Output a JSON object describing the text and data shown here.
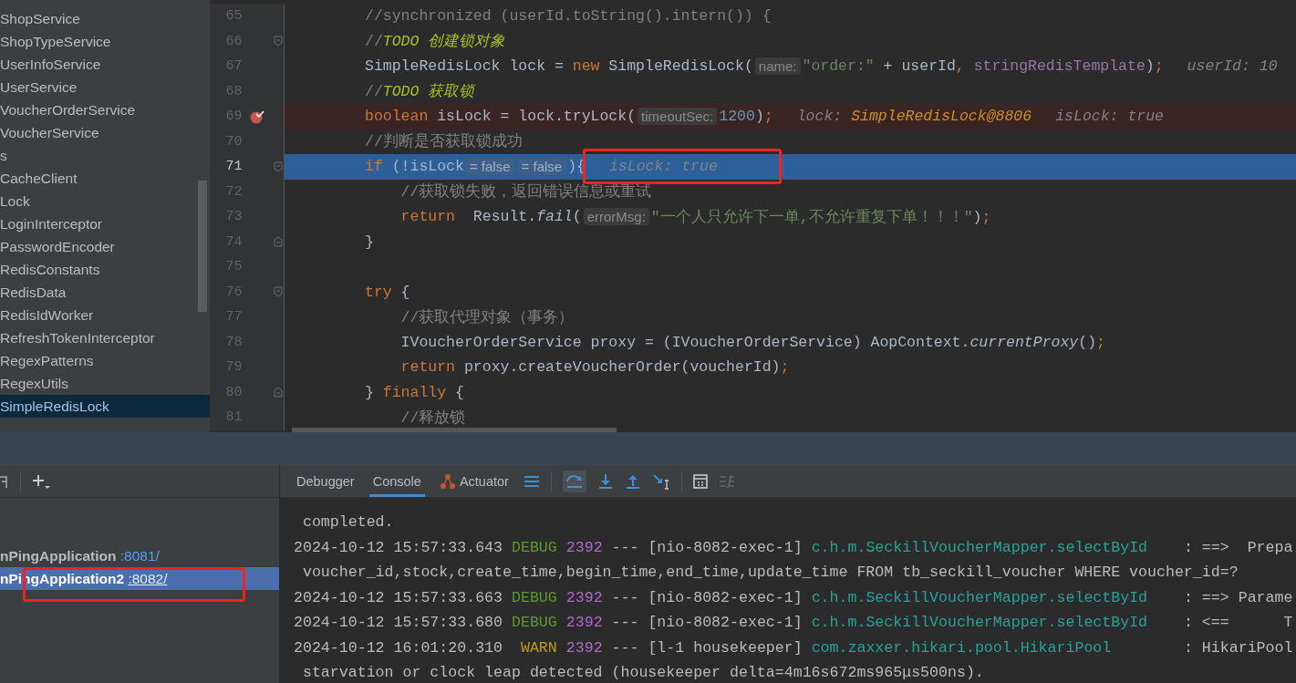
{
  "project_tree": {
    "items": [
      {
        "label": "ShopService",
        "selected": false
      },
      {
        "label": "ShopTypeService",
        "selected": false
      },
      {
        "label": "UserInfoService",
        "selected": false
      },
      {
        "label": "UserService",
        "selected": false
      },
      {
        "label": "VoucherOrderService",
        "selected": false
      },
      {
        "label": "VoucherService",
        "selected": false
      },
      {
        "label": "s",
        "selected": false
      },
      {
        "label": "CacheClient",
        "selected": false
      },
      {
        "label": "Lock",
        "selected": false
      },
      {
        "label": "LoginInterceptor",
        "selected": false
      },
      {
        "label": "PasswordEncoder",
        "selected": false
      },
      {
        "label": "RedisConstants",
        "selected": false
      },
      {
        "label": "RedisData",
        "selected": false
      },
      {
        "label": "RedisIdWorker",
        "selected": false
      },
      {
        "label": "RefreshTokenInterceptor",
        "selected": false
      },
      {
        "label": "RegexPatterns",
        "selected": false
      },
      {
        "label": "RegexUtils",
        "selected": false
      },
      {
        "label": "SimpleRedisLock",
        "selected": true
      }
    ]
  },
  "editor": {
    "lines": [
      {
        "number": "65",
        "parts": [
          {
            "kind": "code",
            "tokens": [
              {
                "kind": "comment",
                "text": "//synchronized (userId.toString().intern()) {"
              }
            ]
          }
        ]
      },
      {
        "number": "66",
        "fold_start": true,
        "parts": [
          {
            "kind": "code",
            "tokens": [
              {
                "kind": "comment",
                "text": "//"
              },
              {
                "kind": "todo",
                "text": "TODO 创建锁对象"
              }
            ]
          }
        ]
      },
      {
        "number": "67",
        "parts": [
          {
            "kind": "code",
            "tokens": [
              {
                "kind": "plain",
                "text": "SimpleRedisLock lock = "
              },
              {
                "kind": "kw",
                "text": "new"
              },
              {
                "kind": "plain",
                "text": " SimpleRedisLock("
              }
            ]
          },
          {
            "kind": "hint",
            "text": "name:"
          },
          {
            "kind": "code",
            "tokens": [
              {
                "kind": "string",
                "text": "\"order:\""
              },
              {
                "kind": "plain",
                "text": " + userId"
              },
              {
                "kind": "kw",
                "text": ", "
              },
              {
                "kind": "field",
                "text": "stringRedisTemplate"
              },
              {
                "kind": "plain",
                "text": ")"
              },
              {
                "kind": "kw",
                "text": ";"
              }
            ]
          },
          {
            "kind": "debug",
            "tokens": [
              {
                "kind": "vlabel",
                "text": "userId: 10"
              }
            ]
          }
        ]
      },
      {
        "number": "68",
        "parts": [
          {
            "kind": "code",
            "tokens": [
              {
                "kind": "comment",
                "text": "//"
              },
              {
                "kind": "todo",
                "text": "TODO 获取锁"
              }
            ]
          }
        ]
      },
      {
        "number": "69",
        "breakpoint": true,
        "parts": [
          {
            "kind": "code",
            "tokens": [
              {
                "kind": "kw",
                "text": "boolean"
              },
              {
                "kind": "plain",
                "text": " isLock = lock.tryLock("
              }
            ]
          },
          {
            "kind": "hint",
            "text": "timeoutSec:"
          },
          {
            "kind": "code",
            "tokens": [
              {
                "kind": "num",
                "text": "1200"
              },
              {
                "kind": "plain",
                "text": ")"
              },
              {
                "kind": "kw",
                "text": ";"
              }
            ]
          },
          {
            "kind": "debug",
            "tokens": [
              {
                "kind": "vlabel",
                "text": "lock: "
              },
              {
                "kind": "vval",
                "text": "SimpleRedisLock@8806"
              }
            ]
          },
          {
            "kind": "debug",
            "tokens": [
              {
                "kind": "vlabel",
                "text": "isLock: true"
              }
            ]
          }
        ]
      },
      {
        "number": "70",
        "parts": [
          {
            "kind": "code",
            "tokens": [
              {
                "kind": "comment",
                "text": "//判断是否获取锁成功"
              }
            ]
          }
        ]
      },
      {
        "number": "71",
        "current": true,
        "fold_start": true,
        "parts": [
          {
            "kind": "code",
            "tokens": [
              {
                "kind": "kw",
                "text": "if"
              },
              {
                "kind": "plain",
                "text": " (!isLock"
              }
            ]
          },
          {
            "kind": "hint",
            "text": "= false"
          },
          {
            "kind": "hint",
            "text": "= false"
          },
          {
            "kind": "code",
            "tokens": [
              {
                "kind": "plain",
                "text": "){"
              }
            ]
          },
          {
            "kind": "debug",
            "annotated": true,
            "tokens": [
              {
                "kind": "vlabel",
                "text": "isLock: true"
              }
            ]
          }
        ]
      },
      {
        "number": "72",
        "parts": [
          {
            "kind": "code",
            "tokens": [
              {
                "kind": "comment",
                "text": "    //获取锁失败，返回错误信息或重试"
              }
            ]
          }
        ]
      },
      {
        "number": "73",
        "parts": [
          {
            "kind": "code",
            "tokens": [
              {
                "kind": "kw",
                "text": "    return"
              },
              {
                "kind": "plain",
                "text": "  Result."
              },
              {
                "kind": "italic",
                "text": "fail"
              },
              {
                "kind": "plain",
                "text": "("
              }
            ]
          },
          {
            "kind": "hint",
            "text": "errorMsg:"
          },
          {
            "kind": "code",
            "tokens": [
              {
                "kind": "string",
                "text": "\"一个人只允许下一单,不允许重复下单！！！\""
              },
              {
                "kind": "plain",
                "text": ")"
              },
              {
                "kind": "kw",
                "text": ";"
              }
            ]
          }
        ]
      },
      {
        "number": "74",
        "fold_end": true,
        "parts": [
          {
            "kind": "code",
            "tokens": [
              {
                "kind": "plain",
                "text": "}"
              }
            ]
          }
        ]
      },
      {
        "number": "75"
      },
      {
        "number": "76",
        "fold_start": true,
        "parts": [
          {
            "kind": "code",
            "tokens": [
              {
                "kind": "kw",
                "text": "try"
              },
              {
                "kind": "plain",
                "text": " {"
              }
            ]
          }
        ]
      },
      {
        "number": "77",
        "parts": [
          {
            "kind": "code",
            "tokens": [
              {
                "kind": "comment",
                "text": "    //获取代理对象（事务）"
              }
            ]
          }
        ]
      },
      {
        "number": "78",
        "parts": [
          {
            "kind": "code",
            "tokens": [
              {
                "kind": "plain",
                "text": "    IVoucherOrderService proxy = (IVoucherOrderService) AopContext."
              },
              {
                "kind": "italic",
                "text": "currentProxy"
              },
              {
                "kind": "plain",
                "text": "()"
              },
              {
                "kind": "kw",
                "text": ";"
              }
            ]
          }
        ]
      },
      {
        "number": "79",
        "parts": [
          {
            "kind": "code",
            "tokens": [
              {
                "kind": "kw",
                "text": "    return"
              },
              {
                "kind": "plain",
                "text": " proxy.createVoucherOrder(voucherId)"
              },
              {
                "kind": "kw",
                "text": ";"
              }
            ]
          }
        ]
      },
      {
        "number": "80",
        "fold_end": true,
        "parts": [
          {
            "kind": "code",
            "tokens": [
              {
                "kind": "plain",
                "text": "} "
              },
              {
                "kind": "kw",
                "text": "finally"
              },
              {
                "kind": "plain",
                "text": " {"
              }
            ]
          }
        ]
      },
      {
        "number": "81",
        "parts": [
          {
            "kind": "code",
            "tokens": [
              {
                "kind": "comment",
                "text": "    //释放锁"
              }
            ]
          }
        ]
      }
    ]
  },
  "run_list": {
    "items": [
      {
        "name": "nPingApplication",
        "port": ":8081/",
        "selected": false
      },
      {
        "name": "nPingApplication2",
        "port": ":8082/",
        "selected": true,
        "annotated": true
      }
    ]
  },
  "debug_tabs": [
    {
      "label": "Debugger",
      "selected": false
    },
    {
      "label": "Console",
      "selected": true
    },
    {
      "label": "Actuator",
      "selected": false
    }
  ],
  "console": {
    "lines": [
      {
        "kind": "wrap",
        "text": " completed."
      },
      {
        "kind": "log",
        "date": "2024-10-12 15:57:33.643",
        "level": "DEBUG",
        "pid": "2392",
        "thread": "--- [nio-8082-exec-1]",
        "logger": "c.h.m.SeckillVoucherMapper.selectById",
        "message": "    : ==>  Prepa"
      },
      {
        "kind": "wrap",
        "text": " voucher_id,stock,create_time,begin_time,end_time,update_time FROM tb_seckill_voucher WHERE voucher_id=?"
      },
      {
        "kind": "log",
        "date": "2024-10-12 15:57:33.663",
        "level": "DEBUG",
        "pid": "2392",
        "thread": "--- [nio-8082-exec-1]",
        "logger": "c.h.m.SeckillVoucherMapper.selectById",
        "message": "    : ==> Parame"
      },
      {
        "kind": "log",
        "date": "2024-10-12 15:57:33.680",
        "level": "DEBUG",
        "pid": "2392",
        "thread": "--- [nio-8082-exec-1]",
        "logger": "c.h.m.SeckillVoucherMapper.selectById",
        "message": "    : <==      T"
      },
      {
        "kind": "log",
        "date": "2024-10-12 16:01:20.310",
        "level": " WARN",
        "pid": "2392",
        "thread": "--- [l-1 housekeeper]",
        "logger": "com.zaxxer.hikari.pool.HikariPool",
        "message": "        : HikariPool"
      },
      {
        "kind": "wrap",
        "text": " starvation or clock leap detected (housekeeper delta=4m16s672ms965μs500ns)."
      }
    ]
  }
}
